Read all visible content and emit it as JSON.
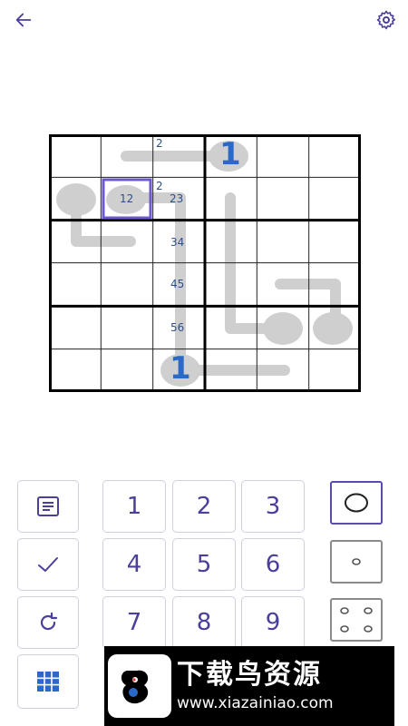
{
  "icons": {
    "back": "arrow-left-icon",
    "settings": "gear-icon",
    "notes": "document-icon",
    "check": "checkmark-icon",
    "reset": "refresh-icon",
    "grid": "grid-icon"
  },
  "colors": {
    "accent": "#5b4bb0",
    "number": "#4a3f9a",
    "clue_big": "#2a69c8",
    "clue_small": "#2d4f86",
    "path": "#cfcfcf"
  },
  "board": {
    "size": 6,
    "selected_cell": "12",
    "small_labels": [
      "2",
      "2",
      "23",
      "34",
      "45",
      "56"
    ],
    "big_labels": [
      "1",
      "1"
    ]
  },
  "keypad": {
    "numbers": [
      "1",
      "2",
      "3",
      "4",
      "5",
      "6",
      "7",
      "8",
      "9"
    ]
  },
  "watermark": {
    "title": "下载鸟资源",
    "url": "www.xiazainiao.com"
  }
}
